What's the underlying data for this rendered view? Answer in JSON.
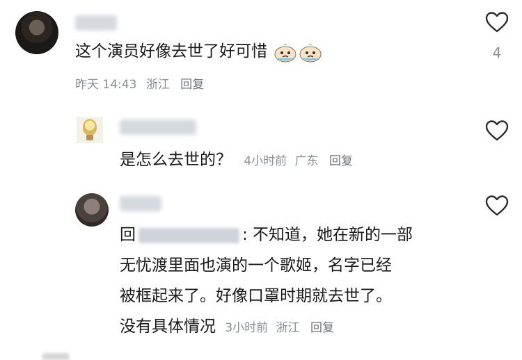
{
  "comments": [
    {
      "text": "这个演员好像去世了好可惜",
      "time": "昨天 14:43",
      "location": "浙江",
      "reply_label": "回复",
      "likes": "4",
      "emojis": [
        "crying-baby-emoji",
        "crying-baby-emoji"
      ]
    },
    {
      "text": "是怎么去世的？",
      "time": "4小时前",
      "location": "广东",
      "reply_label": "回复"
    },
    {
      "reply_prefix": "回",
      "text_after_name": ": 不知道，她在新的一部",
      "line2": "无忧渡里面也演的一个歌姬，名字已经",
      "line3": "被框起来了。好像口罩时期就去世了。",
      "line4": "没有具体情况",
      "time": "3小时前",
      "location": "浙江",
      "reply_label": "回复"
    }
  ],
  "icons": {
    "like": "heart-outline-icon"
  },
  "colors": {
    "text": "#1a1a1a",
    "meta": "#8a8d91",
    "heart": "#2b2b2b"
  }
}
